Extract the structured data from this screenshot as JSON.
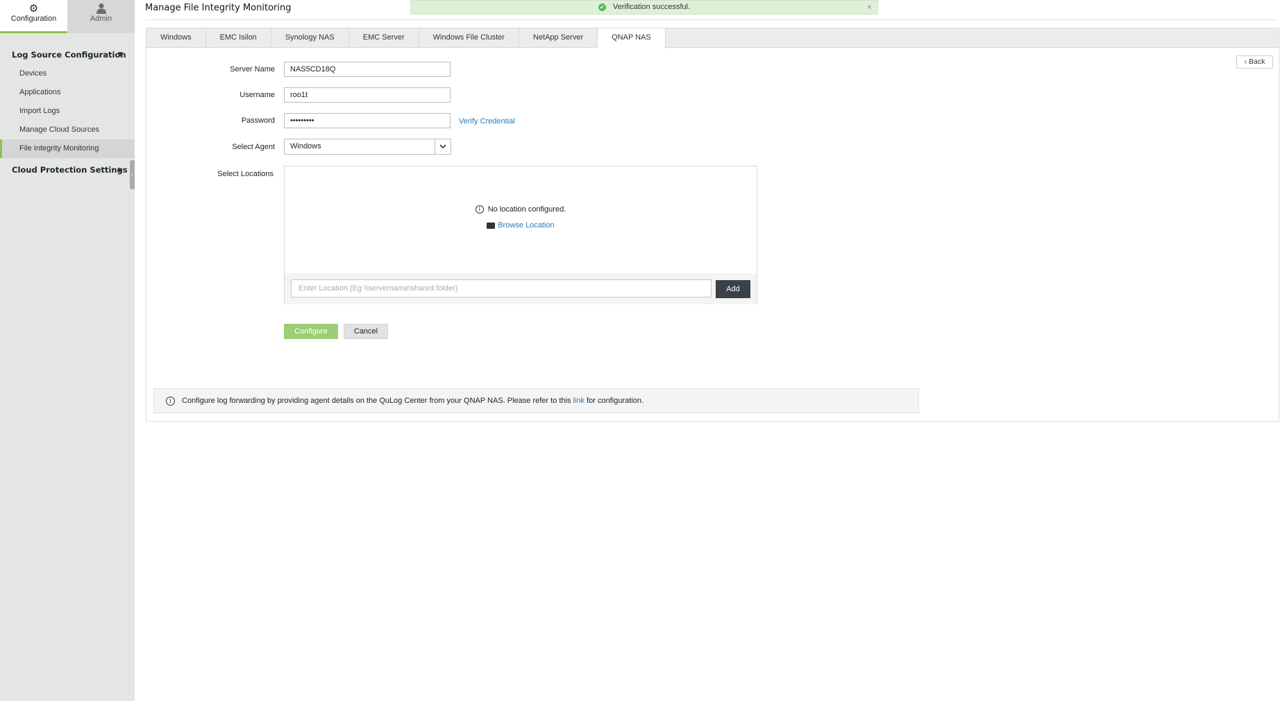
{
  "sidebar": {
    "topnav": [
      {
        "label": "Configuration",
        "icon": "gear-icon",
        "active": true
      },
      {
        "label": "Admin",
        "icon": "user-icon",
        "active": false
      }
    ],
    "sections": [
      {
        "label": "Log Source Configuration",
        "expanded": true,
        "items": [
          "Devices",
          "Applications",
          "Import Logs",
          "Manage Cloud Sources",
          "File Integrity Monitoring"
        ],
        "active_item": "File Integrity Monitoring"
      },
      {
        "label": "Cloud Protection Settings",
        "expanded": false
      }
    ]
  },
  "page": {
    "title": "Manage File Integrity Monitoring"
  },
  "toast": {
    "message": "Verification successful.",
    "close": "×"
  },
  "tabs": [
    "Windows",
    "EMC Isilon",
    "Synology NAS",
    "EMC Server",
    "Windows File Cluster",
    "NetApp Server",
    "QNAP NAS"
  ],
  "active_tab": "QNAP NAS",
  "back_label": "Back",
  "form": {
    "server_name": {
      "label": "Server Name",
      "value": "NAS5CD18Q"
    },
    "username": {
      "label": "Username",
      "value": "roo1t"
    },
    "password": {
      "label": "Password",
      "value": "•••••••••"
    },
    "verify_link": "Verify Credential",
    "agent": {
      "label": "Select Agent",
      "value": "Windows"
    },
    "locations": {
      "label": "Select Locations",
      "empty_text": "No location configured.",
      "browse_label": "Browse Location",
      "input_placeholder": "Enter Location (Eg \\\\servername\\shared folder)",
      "add_label": "Add"
    },
    "configure_label": "Configure",
    "cancel_label": "Cancel"
  },
  "note": {
    "before": "Configure log forwarding by providing agent details on the QuLog Center from your QNAP NAS. Please refer to this ",
    "link": "link",
    "after": " for configuration."
  },
  "colors": {
    "accent_green": "#8bc34a",
    "link_blue": "#2a7ab8",
    "configure_green": "#9bce76",
    "add_dark": "#3a4148"
  }
}
